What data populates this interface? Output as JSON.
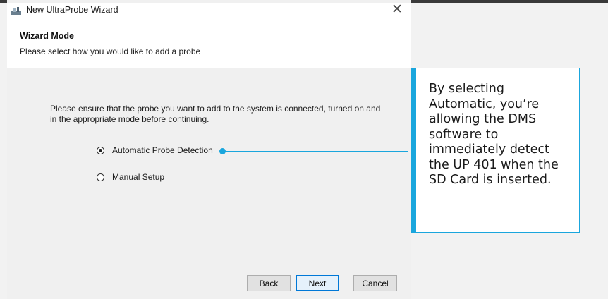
{
  "window": {
    "title": "New UltraProbe Wizard",
    "close_glyph": "✕"
  },
  "header": {
    "title": "Wizard Mode",
    "subtitle": "Please select how you would like to add a probe"
  },
  "instructions": "Please ensure that the probe you want to add to the system is connected, turned on and in the appropriate mode before continuing.",
  "options": [
    {
      "label": "Automatic Probe Detection",
      "selected": true
    },
    {
      "label": "Manual Setup",
      "selected": false
    }
  ],
  "buttons": {
    "back": "Back",
    "next": "Next",
    "cancel": "Cancel"
  },
  "callout": {
    "text": "By selecting Automatic, you’re allowing the DMS software to immediately detect the UP 401 when the SD Card is inserted."
  },
  "colors": {
    "accent": "#1aa6dd",
    "default_button_border": "#0078d7"
  },
  "icons": {
    "app": "probe-app-icon",
    "close": "close-icon"
  }
}
